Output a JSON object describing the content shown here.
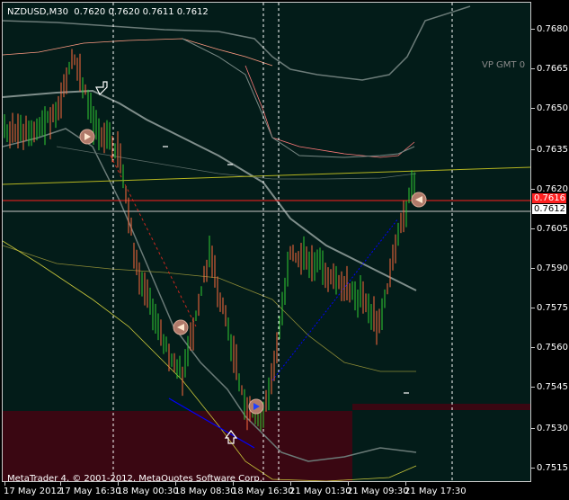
{
  "header": {
    "symbol_timeframe": "NZDUSD,M30",
    "ohlc_text": "0.7620 0.7620 0.7611 0.7612"
  },
  "indicator_label": "VP GMT 0",
  "copyright": "MetaTrader 4, © 2001-2012, MetaQuotes Software Corp.",
  "price_axis": {
    "labels": [
      "0.7680",
      "0.7665",
      "0.7650",
      "0.7635",
      "0.7620",
      "0.7605",
      "0.7590",
      "0.7575",
      "0.7560",
      "0.7545",
      "0.7530",
      "0.7515"
    ],
    "bid_tag": "0.7612",
    "marker_tag": "0.7616"
  },
  "time_axis": {
    "labels": [
      "17 May 2012",
      "17 May 16:30",
      "18 May 00:30",
      "18 May 08:30",
      "18 May 16:30",
      "21 May 01:30",
      "21 May 09:30",
      "21 May 17:30"
    ]
  },
  "colors": {
    "background": "#031c19",
    "bull_candle": "#32cd32",
    "bear_candle": "#ff6a3d",
    "bid_line": "#ff2020",
    "trend_line": "#b5b520",
    "channel": "#0000ff",
    "zone": "#3a0712"
  },
  "chart_data": {
    "type": "candlestick",
    "symbol": "NZDUSD",
    "timeframe": "M30",
    "last_bar": {
      "open": 0.762,
      "high": 0.762,
      "low": 0.7611,
      "close": 0.7612
    },
    "ylim": [
      0.751,
      0.769
    ],
    "horizontal_levels": [
      {
        "price": 0.7612,
        "color": "#c8c8c8"
      },
      {
        "price": 0.7616,
        "color": "#ff2020"
      }
    ],
    "session_separators": [
      "17 May 16:30",
      "18 May 16:30",
      "21 May 01:30",
      "21 May 17:30"
    ]
  }
}
